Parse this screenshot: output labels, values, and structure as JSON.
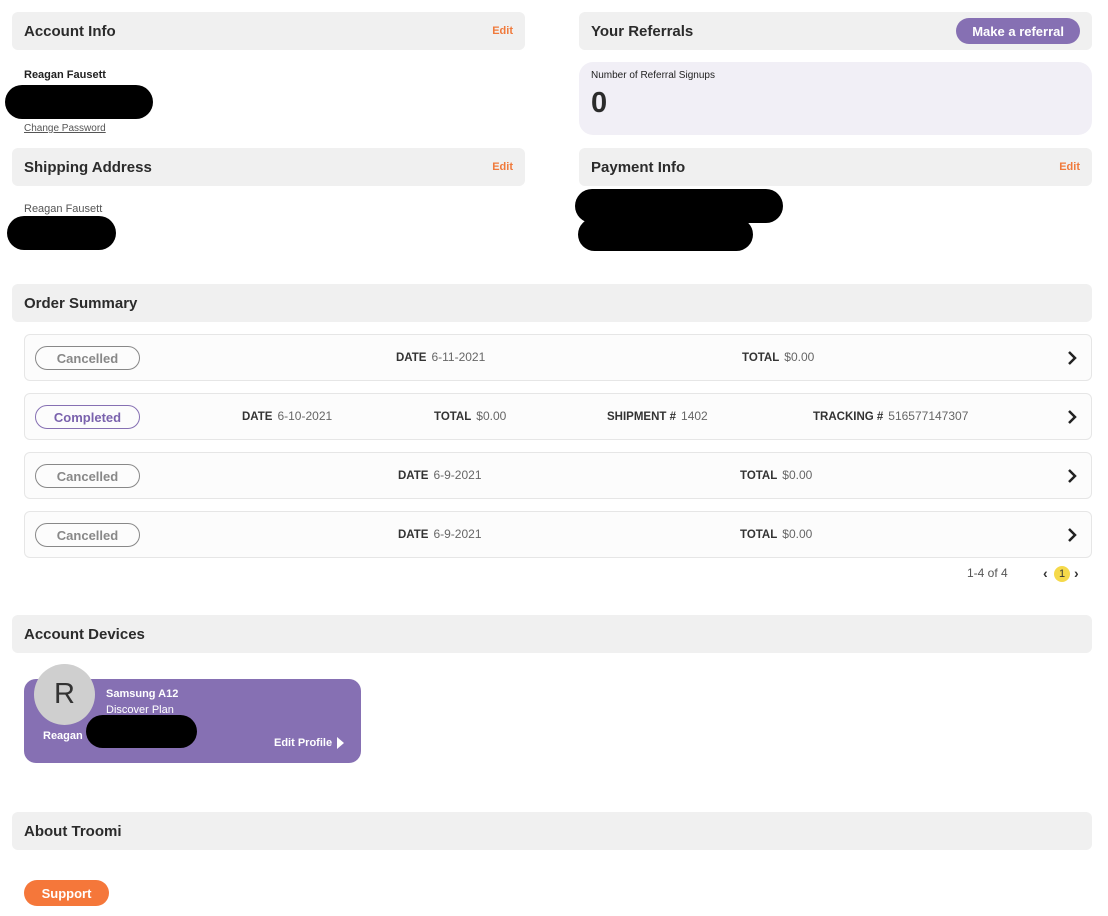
{
  "account_info": {
    "title": "Account Info",
    "edit_label": "Edit",
    "name": "Reagan Fausett",
    "change_password": "Change Password"
  },
  "referrals": {
    "title": "Your Referrals",
    "button_label": "Make a referral",
    "signups_label": "Number of Referral Signups",
    "signups_count": "0"
  },
  "shipping": {
    "title": "Shipping Address",
    "edit_label": "Edit",
    "name": "Reagan Fausett"
  },
  "payment": {
    "title": "Payment Info",
    "edit_label": "Edit"
  },
  "orders": {
    "title": "Order Summary",
    "labels": {
      "date": "DATE",
      "total": "TOTAL",
      "shipment": "SHIPMENT #",
      "tracking": "TRACKING #"
    },
    "rows": [
      {
        "status": "Cancelled",
        "date": "6-11-2021",
        "total": "$0.00"
      },
      {
        "status": "Completed",
        "date": "6-10-2021",
        "total": "$0.00",
        "shipment": "1402",
        "tracking": "516577147307"
      },
      {
        "status": "Cancelled",
        "date": "6-9-2021",
        "total": "$0.00"
      },
      {
        "status": "Cancelled",
        "date": "6-9-2021",
        "total": "$0.00"
      }
    ],
    "pagination": {
      "range": "1-4 of 4",
      "current_page": "1",
      "prev": "‹",
      "next": "›"
    }
  },
  "devices": {
    "title": "Account Devices",
    "items": [
      {
        "avatar_letter": "R",
        "device": "Samsung A12",
        "plan": "Discover Plan",
        "owner": "Reagan",
        "edit_label": "Edit Profile"
      }
    ]
  },
  "about": {
    "title": "About Troomi",
    "support_label": "Support"
  },
  "colors": {
    "accent_purple": "#8670b3",
    "accent_orange": "#f5773a",
    "edit_orange": "#f07a3c",
    "header_bg": "#f0f0f0",
    "highlight_yellow": "#f5d94a"
  },
  "icons": {
    "row_chevron": "chevron-right-icon",
    "profile_arrow": "triangle-right-icon"
  }
}
